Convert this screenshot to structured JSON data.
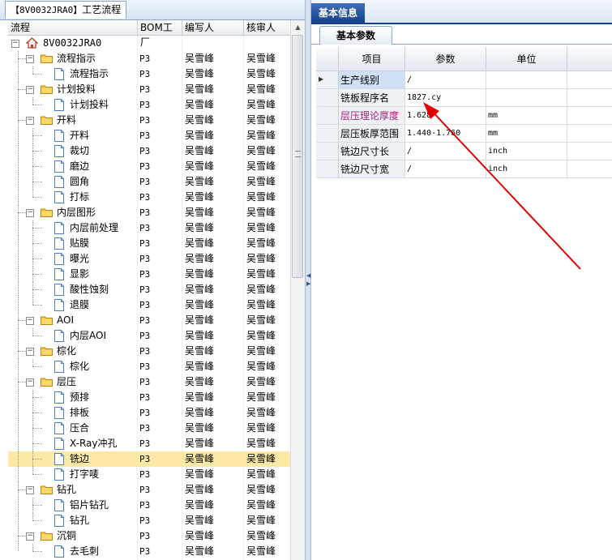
{
  "left_panel": {
    "tab": {
      "code": "【8V0032JRA0】",
      "title": "工艺流程"
    },
    "columns": [
      "流程",
      "BOM工厂",
      "编写人",
      "核审人"
    ],
    "rows": [
      {
        "label": "8V0032JRA0",
        "level": 0,
        "type": "root",
        "bom": "",
        "writer": "",
        "reviewer": ""
      },
      {
        "label": "流程指示",
        "level": 1,
        "type": "folder",
        "bom": "P3",
        "writer": "吴雪峰",
        "reviewer": "吴雪峰"
      },
      {
        "label": "流程指示",
        "level": 2,
        "type": "doc",
        "bom": "P3",
        "writer": "吴雪峰",
        "reviewer": "吴雪峰"
      },
      {
        "label": "计划投料",
        "level": 1,
        "type": "folder",
        "bom": "P3",
        "writer": "吴雪峰",
        "reviewer": "吴雪峰"
      },
      {
        "label": "计划投料",
        "level": 2,
        "type": "doc",
        "bom": "P3",
        "writer": "吴雪峰",
        "reviewer": "吴雪峰"
      },
      {
        "label": "开料",
        "level": 1,
        "type": "folder",
        "bom": "P3",
        "writer": "吴雪峰",
        "reviewer": "吴雪峰"
      },
      {
        "label": "开料",
        "level": 2,
        "type": "doc",
        "bom": "P3",
        "writer": "吴雪峰",
        "reviewer": "吴雪峰"
      },
      {
        "label": "裁切",
        "level": 2,
        "type": "doc",
        "bom": "P3",
        "writer": "吴雪峰",
        "reviewer": "吴雪峰"
      },
      {
        "label": "磨边",
        "level": 2,
        "type": "doc",
        "bom": "P3",
        "writer": "吴雪峰",
        "reviewer": "吴雪峰"
      },
      {
        "label": "圆角",
        "level": 2,
        "type": "doc",
        "bom": "P3",
        "writer": "吴雪峰",
        "reviewer": "吴雪峰"
      },
      {
        "label": "打标",
        "level": 2,
        "type": "doc",
        "bom": "P3",
        "writer": "吴雪峰",
        "reviewer": "吴雪峰"
      },
      {
        "label": "内层图形",
        "level": 1,
        "type": "folder",
        "bom": "P3",
        "writer": "吴雪峰",
        "reviewer": "吴雪峰"
      },
      {
        "label": "内层前处理",
        "level": 2,
        "type": "doc",
        "bom": "P3",
        "writer": "吴雪峰",
        "reviewer": "吴雪峰"
      },
      {
        "label": "贴膜",
        "level": 2,
        "type": "doc",
        "bom": "P3",
        "writer": "吴雪峰",
        "reviewer": "吴雪峰"
      },
      {
        "label": "曝光",
        "level": 2,
        "type": "doc",
        "bom": "P3",
        "writer": "吴雪峰",
        "reviewer": "吴雪峰"
      },
      {
        "label": "显影",
        "level": 2,
        "type": "doc",
        "bom": "P3",
        "writer": "吴雪峰",
        "reviewer": "吴雪峰"
      },
      {
        "label": "酸性蚀刻",
        "level": 2,
        "type": "doc",
        "bom": "P3",
        "writer": "吴雪峰",
        "reviewer": "吴雪峰"
      },
      {
        "label": "退膜",
        "level": 2,
        "type": "doc",
        "bom": "P3",
        "writer": "吴雪峰",
        "reviewer": "吴雪峰"
      },
      {
        "label": "AOI",
        "level": 1,
        "type": "folder",
        "bom": "P3",
        "writer": "吴雪峰",
        "reviewer": "吴雪峰"
      },
      {
        "label": "内层AOI",
        "level": 2,
        "type": "doc",
        "bom": "P3",
        "writer": "吴雪峰",
        "reviewer": "吴雪峰"
      },
      {
        "label": "棕化",
        "level": 1,
        "type": "folder",
        "bom": "P3",
        "writer": "吴雪峰",
        "reviewer": "吴雪峰"
      },
      {
        "label": "棕化",
        "level": 2,
        "type": "doc",
        "bom": "P3",
        "writer": "吴雪峰",
        "reviewer": "吴雪峰"
      },
      {
        "label": "层压",
        "level": 1,
        "type": "folder",
        "bom": "P3",
        "writer": "吴雪峰",
        "reviewer": "吴雪峰"
      },
      {
        "label": "预排",
        "level": 2,
        "type": "doc",
        "bom": "P3",
        "writer": "吴雪峰",
        "reviewer": "吴雪峰"
      },
      {
        "label": "排板",
        "level": 2,
        "type": "doc",
        "bom": "P3",
        "writer": "吴雪峰",
        "reviewer": "吴雪峰"
      },
      {
        "label": "压合",
        "level": 2,
        "type": "doc",
        "bom": "P3",
        "writer": "吴雪峰",
        "reviewer": "吴雪峰"
      },
      {
        "label": "X-Ray冲孔",
        "level": 2,
        "type": "doc",
        "bom": "P3",
        "writer": "吴雪峰",
        "reviewer": "吴雪峰"
      },
      {
        "label": "铣边",
        "level": 2,
        "type": "doc",
        "bom": "P3",
        "writer": "吴雪峰",
        "reviewer": "吴雪峰",
        "selected": true
      },
      {
        "label": "打字唛",
        "level": 2,
        "type": "doc",
        "bom": "P3",
        "writer": "吴雪峰",
        "reviewer": "吴雪峰"
      },
      {
        "label": "钻孔",
        "level": 1,
        "type": "folder",
        "bom": "P3",
        "writer": "吴雪峰",
        "reviewer": "吴雪峰"
      },
      {
        "label": "铝片钻孔",
        "level": 2,
        "type": "doc",
        "bom": "P3",
        "writer": "吴雪峰",
        "reviewer": "吴雪峰"
      },
      {
        "label": "钻孔",
        "level": 2,
        "type": "doc",
        "bom": "P3",
        "writer": "吴雪峰",
        "reviewer": "吴雪峰"
      },
      {
        "label": "沉铜",
        "level": 1,
        "type": "folder",
        "bom": "P3",
        "writer": "吴雪峰",
        "reviewer": "吴雪峰"
      },
      {
        "label": "去毛刺",
        "level": 2,
        "type": "doc",
        "bom": "P3",
        "writer": "吴雪峰",
        "reviewer": "吴雪峰"
      }
    ]
  },
  "right_panel": {
    "tab": "基本信息",
    "subtab": "基本参数",
    "columns": [
      "项目",
      "参数",
      "单位"
    ],
    "rows": [
      {
        "item": "生产线别",
        "value": "/",
        "unit": "",
        "current": true,
        "highlight": false
      },
      {
        "item": "铣板程序名",
        "value": "1827.cy",
        "unit": "",
        "current": false,
        "highlight": false
      },
      {
        "item": "层压理论厚度",
        "value": "1.628",
        "unit": "mm",
        "current": false,
        "highlight": true
      },
      {
        "item": "层压板厚范围",
        "value": "1.440-1.760",
        "unit": "mm",
        "current": false,
        "highlight": false
      },
      {
        "item": "铣边尺寸长",
        "value": "/",
        "unit": "inch",
        "current": false,
        "highlight": false
      },
      {
        "item": "铣边尺寸宽",
        "value": "/",
        "unit": "inch",
        "current": false,
        "highlight": false
      }
    ]
  },
  "colors": {
    "accent": "#15428b",
    "selected_row": "#fde9a6",
    "highlight_text": "#a0207a",
    "annotation": "#e00000"
  }
}
